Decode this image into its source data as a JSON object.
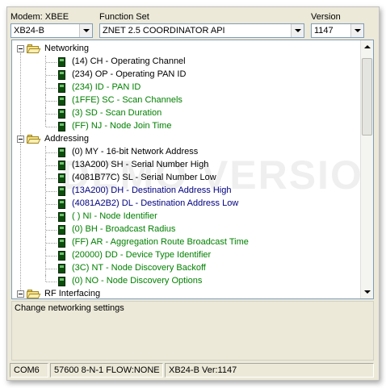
{
  "toolbar": {
    "modem_label": "Modem: XBEE",
    "modem_value": "XB24-B",
    "function_label": "Function Set",
    "function_value": "ZNET 2.5 COORDINATOR API",
    "version_label": "Version",
    "version_value": "1147"
  },
  "tree": {
    "watermark": "DEMO VERSION",
    "categories": [
      {
        "label": "Networking",
        "params": [
          {
            "text": "(14) CH - Operating Channel",
            "color": "black"
          },
          {
            "text": "(234) OP - Operating PAN ID",
            "color": "black"
          },
          {
            "text": "(234) ID - PAN ID",
            "color": "green"
          },
          {
            "text": "(1FFE) SC - Scan Channels",
            "color": "green"
          },
          {
            "text": "(3) SD - Scan Duration",
            "color": "green"
          },
          {
            "text": "(FF) NJ - Node Join Time",
            "color": "green"
          }
        ]
      },
      {
        "label": "Addressing",
        "params": [
          {
            "text": "(0) MY - 16-bit Network Address",
            "color": "black"
          },
          {
            "text": "(13A200) SH - Serial Number High",
            "color": "black"
          },
          {
            "text": "(4081B77C) SL - Serial Number Low",
            "color": "black"
          },
          {
            "text": "(13A200) DH - Destination Address High",
            "color": "blue"
          },
          {
            "text": "(4081A2B2) DL - Destination Address Low",
            "color": "blue"
          },
          {
            "text": "( ) NI - Node Identifier",
            "color": "green"
          },
          {
            "text": "(0) BH - Broadcast Radius",
            "color": "green"
          },
          {
            "text": "(FF) AR - Aggregation Route Broadcast Time",
            "color": "green"
          },
          {
            "text": "(20000) DD - Device Type Identifier",
            "color": "green"
          },
          {
            "text": "(3C) NT - Node Discovery Backoff",
            "color": "green"
          },
          {
            "text": "(0) NO - Node Discovery Options",
            "color": "green"
          }
        ]
      },
      {
        "label": "RF Interfacing",
        "params": []
      }
    ]
  },
  "description": "Change networking settings",
  "statusbar": {
    "port": "COM6",
    "settings": "57600 8-N-1  FLOW:NONE",
    "device": "XB24-B  Ver:1147"
  },
  "colors": {
    "black": "#000000",
    "green": "#008000",
    "blue": "#000080"
  }
}
